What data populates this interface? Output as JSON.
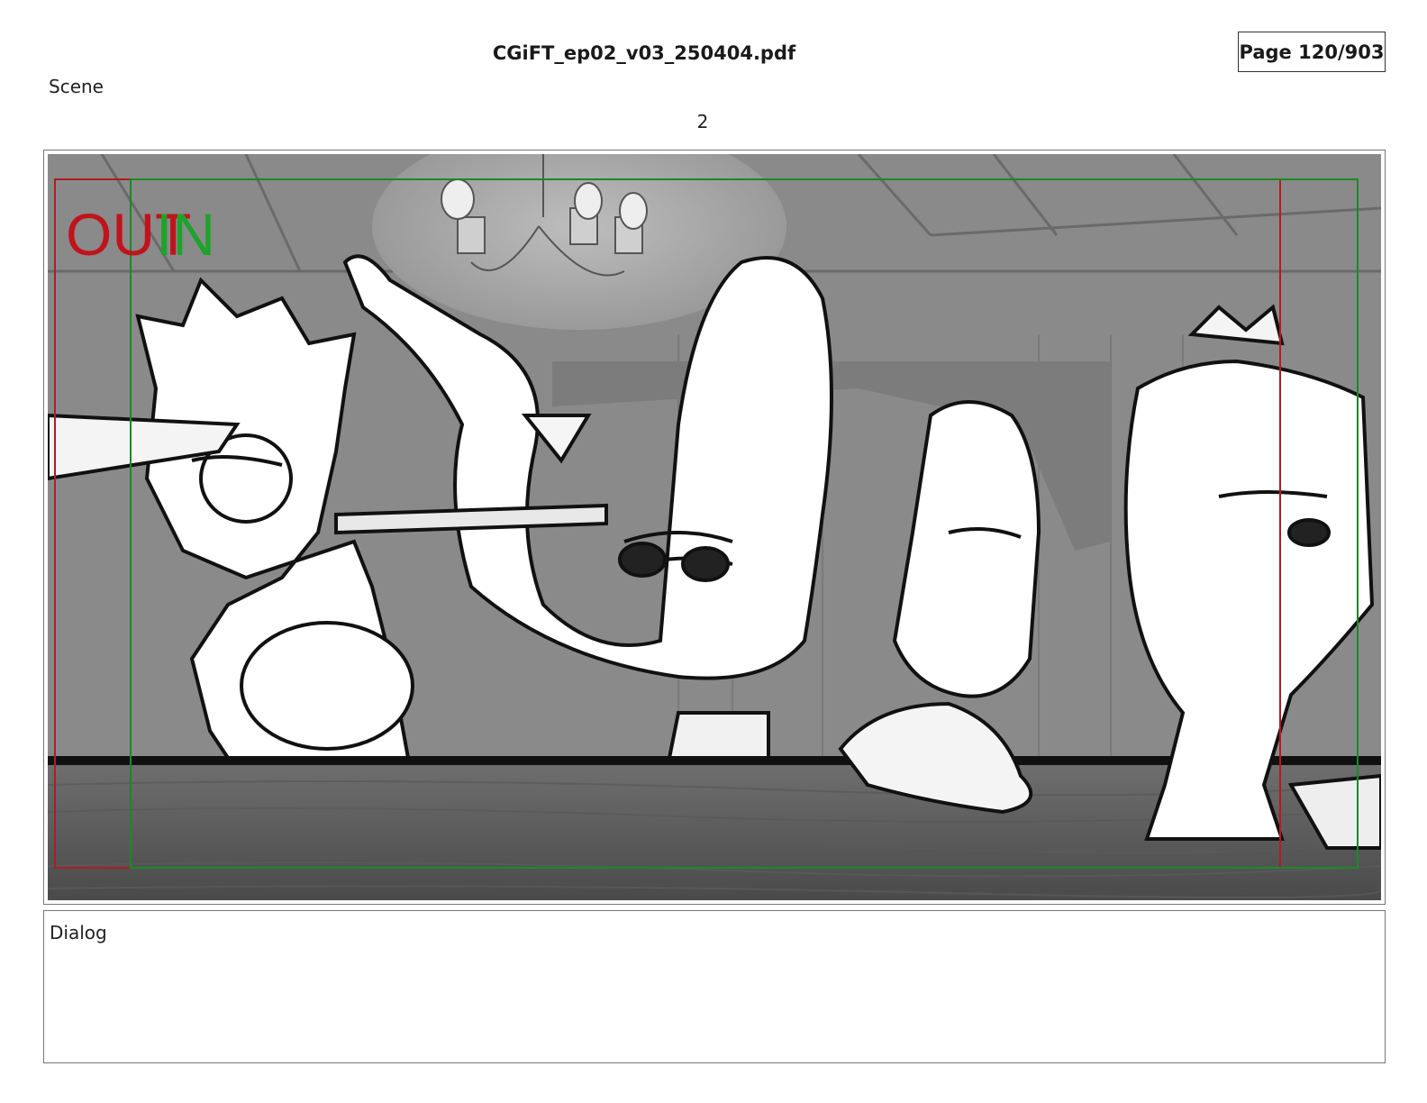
{
  "header": {
    "filename": "CGiFT_ep02_v03_250404.pdf",
    "page_indicator": "Page 120/903"
  },
  "scene": {
    "label": "Scene",
    "number": "2"
  },
  "panel": {
    "out_marker": "OUT",
    "in_marker": "IN",
    "colors": {
      "out": "#c0141c",
      "in": "#1ea32a",
      "safe_frame_red": "#b01c24",
      "safe_frame_green": "#1a8a25"
    }
  },
  "dialog": {
    "label": "Dialog",
    "text": ""
  }
}
